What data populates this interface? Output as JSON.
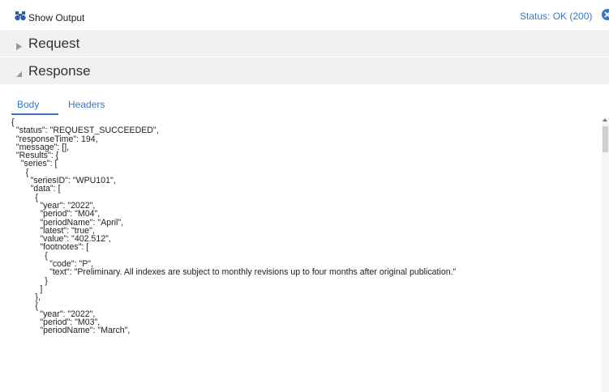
{
  "header": {
    "show_output_label": "Show Output",
    "status_text": "Status: OK (200)",
    "icons": [
      "binoculars-icon",
      "close-circle-icon"
    ],
    "accent_color": "#3a78c3"
  },
  "sections": {
    "request_label": "Request",
    "response_label": "Response"
  },
  "tabs": {
    "body_label": "Body",
    "headers_label": "Headers",
    "active": "Body"
  },
  "response_body_lines": [
    "{",
    "  \"status\": \"REQUEST_SUCCEEDED\",",
    "  \"responseTime\": 194,",
    "  \"message\": [],",
    "  \"Results\": {",
    "    \"series\": [",
    "      {",
    "        \"seriesID\": \"WPU101\",",
    "        \"data\": [",
    "          {",
    "            \"year\": \"2022\",",
    "            \"period\": \"M04\",",
    "            \"periodName\": \"April\",",
    "            \"latest\": \"true\",",
    "            \"value\": \"402.512\",",
    "            \"footnotes\": [",
    "              {",
    "                \"code\": \"P\",",
    "                \"text\": \"Preliminary. All indexes are subject to monthly revisions up to four months after original publication.\"",
    "              }",
    "            ]",
    "          },",
    "          {",
    "            \"year\": \"2022\",",
    "            \"period\": \"M03\",",
    "            \"periodName\": \"March\","
  ]
}
